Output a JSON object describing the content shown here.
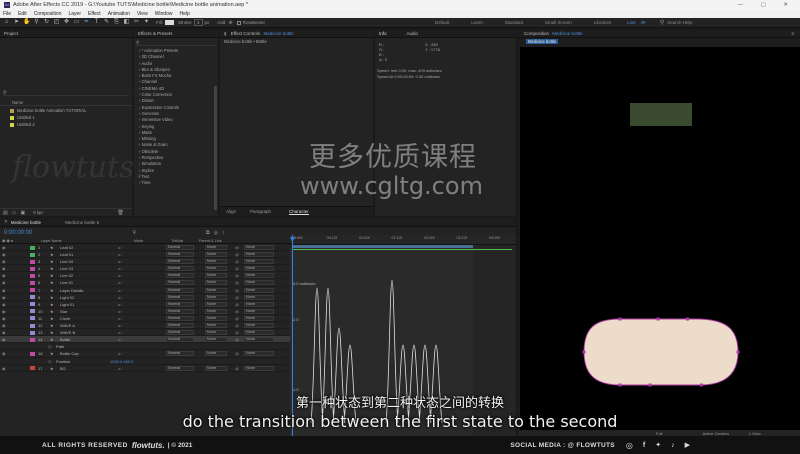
{
  "window": {
    "title": "Adobe After Effects CC 2019 - G:\\Youtube TUTS\\Medicine bottle\\Medicine bottle animation.aep *"
  },
  "menu": [
    "File",
    "Edit",
    "Composition",
    "Layer",
    "Effect",
    "Animation",
    "View",
    "Window",
    "Help"
  ],
  "toolbar": {
    "fill_label": "Fill:",
    "stroke_label": "Stroke:",
    "stroke_width": "2",
    "px_label": "px",
    "add_label": "Add:",
    "rotobezier_label": "RotoBezier",
    "workspaces": [
      "Default",
      "Learn",
      "Standard",
      "Small Screen",
      "Libraries"
    ],
    "active_workspace_label": "Line",
    "search_placeholder": "Search Help"
  },
  "project_panel": {
    "title": "Project",
    "search_placeholder": "",
    "name_header": "Name",
    "items": [
      {
        "name": "Medicine bottle Animation TUTORIAL",
        "color": "#b89c4a",
        "icon": "folder-icon"
      },
      {
        "name": "Untitled 1",
        "color": "#d8d14a",
        "icon": "folder-icon"
      },
      {
        "name": "Untitled 2",
        "color": "#d8d14a",
        "icon": "folder-icon"
      }
    ],
    "bpc_label": "8 bpc"
  },
  "effects_panel": {
    "title": "Effects & Presets",
    "items": [
      "* Animation Presets",
      "3D Channel",
      "Audio",
      "Blur & Sharpen",
      "Boris FX Mocha",
      "Channel",
      "CINEMA 4D",
      "Color Correction",
      "Distort",
      "Expression Controls",
      "Generate",
      "Immersive Video",
      "Keying",
      "Matte",
      "Missing",
      "Noise & Grain",
      "Obsolete",
      "Perspective",
      "Simulation",
      "Stylize",
      "Text",
      "Time"
    ]
  },
  "effect_controls": {
    "title": "Effect Controls",
    "comp_name": "Medicine bottle",
    "breadcrumb": "Medicine bottle • Bottle",
    "tabs": [
      "Align",
      "Paragraph",
      "Character"
    ],
    "active_tab": "Character"
  },
  "info_panel": {
    "tabs": [
      "Info",
      "Audio"
    ],
    "r": "R :",
    "g": "G :",
    "b": "B :",
    "a": "A : 0",
    "x": "X : 330",
    "y": "Y : 1778",
    "speed_line1": "Speed: min 0.00; max: 409 units/sec",
    "speed_line2": "Speed At 0:00:00:00: 0.00 units/sec"
  },
  "composition_panel": {
    "title": "Composition",
    "comp_name": "Medicine bottle",
    "tab_label": "Medicine bottle",
    "zoom": "Full",
    "camera": "Active Camera",
    "view_count": "1 View",
    "colors": {
      "cap": "#3a4a2f",
      "bottle_body": "#ecdcc9",
      "bottle_stroke": "#b03aa8"
    }
  },
  "timeline": {
    "tabs": [
      "Medicine bottle",
      "Medicine bottle 5"
    ],
    "timecode": "0:00:00:00",
    "col_headers": {
      "label": "Layer Name",
      "mode": "Mode",
      "trkmat": "TrkMat",
      "parent": "Parent & Link"
    },
    "layers": [
      {
        "num": "1",
        "name": "Leaf 02",
        "color": "#49b061",
        "mode": "Normal",
        "trkmat": "None",
        "parent": "None"
      },
      {
        "num": "2",
        "name": "Leaf 01",
        "color": "#49b061",
        "mode": "Normal",
        "trkmat": "None",
        "parent": "None"
      },
      {
        "num": "3",
        "name": "Line 04",
        "color": "#c04aa8",
        "mode": "Normal",
        "trkmat": "None",
        "parent": "None"
      },
      {
        "num": "4",
        "name": "Line 03",
        "color": "#c04aa8",
        "mode": "Normal",
        "trkmat": "None",
        "parent": "None"
      },
      {
        "num": "5",
        "name": "Line 02",
        "color": "#c04aa8",
        "mode": "Normal",
        "trkmat": "None",
        "parent": "None"
      },
      {
        "num": "6",
        "name": "Line 01",
        "color": "#c04aa8",
        "mode": "Normal",
        "trkmat": "None",
        "parent": "None"
      },
      {
        "num": "7",
        "name": "Layer Details",
        "color": "#c04aa8",
        "mode": "Normal",
        "trkmat": "None",
        "parent": "None"
      },
      {
        "num": "8",
        "name": "Light 02",
        "color": "#8e8ed6",
        "mode": "Normal",
        "trkmat": "None",
        "parent": "None"
      },
      {
        "num": "9",
        "name": "Light 01",
        "color": "#8e8ed6",
        "mode": "Normal",
        "trkmat": "None",
        "parent": "None"
      },
      {
        "num": "10",
        "name": "Star",
        "color": "#8e8ed6",
        "mode": "Normal",
        "trkmat": "None",
        "parent": "None"
      },
      {
        "num": "11",
        "name": "Circle",
        "color": "#8e8ed6",
        "mode": "Normal",
        "trkmat": "None",
        "parent": "None"
      },
      {
        "num": "12",
        "name": "WAVE A",
        "color": "#8e8ed6",
        "mode": "Normal",
        "trkmat": "None",
        "parent": "None"
      },
      {
        "num": "13",
        "name": "WAVE B",
        "color": "#8e8ed6",
        "mode": "Normal",
        "trkmat": "None",
        "parent": "None"
      },
      {
        "num": "14",
        "name": "Bottle",
        "color": "#c04aa8",
        "mode": "Normal",
        "trkmat": "None",
        "parent": "None",
        "selected": true
      },
      {
        "num": "",
        "name": "Path",
        "color": "",
        "mode": "",
        "trkmat": "",
        "parent": "",
        "sub": true
      },
      {
        "num": "16",
        "name": "Bottle Cap",
        "color": "#c04aa8",
        "mode": "Normal",
        "trkmat": "None",
        "parent": "None"
      },
      {
        "num": "",
        "name": "Position",
        "color": "",
        "mode": "",
        "trkmat": "",
        "parent": "",
        "sub": true,
        "value": "1000.0,460.0"
      },
      {
        "num": "17",
        "name": "BG",
        "color": "#c9423f",
        "mode": "Normal",
        "trkmat": "None",
        "parent": "None"
      }
    ],
    "ruler_ticks": [
      "0:00f",
      "00:12f",
      "01:00f",
      "01:12f",
      "02:00f",
      "02:12f",
      "03:00f"
    ],
    "graph_labels": [
      "0.0 units/sec",
      "2.0",
      "1.0"
    ],
    "graph_label_top": "0.0 units/sec"
  },
  "watermark": {
    "chinese": "更多优质课程",
    "url": "www.cgltg.com",
    "brand": "flowtuts."
  },
  "subtitles": {
    "chinese": "第一种状态到第二种状态之间的转换",
    "english": "do the transition between the first state to the second"
  },
  "footer": {
    "rights": "ALL RIGHTS RESERVED",
    "brand": "flowtuts.",
    "year": "| © 2021",
    "social": "SOCIAL MEDIA : @ FLOWTUTS"
  }
}
